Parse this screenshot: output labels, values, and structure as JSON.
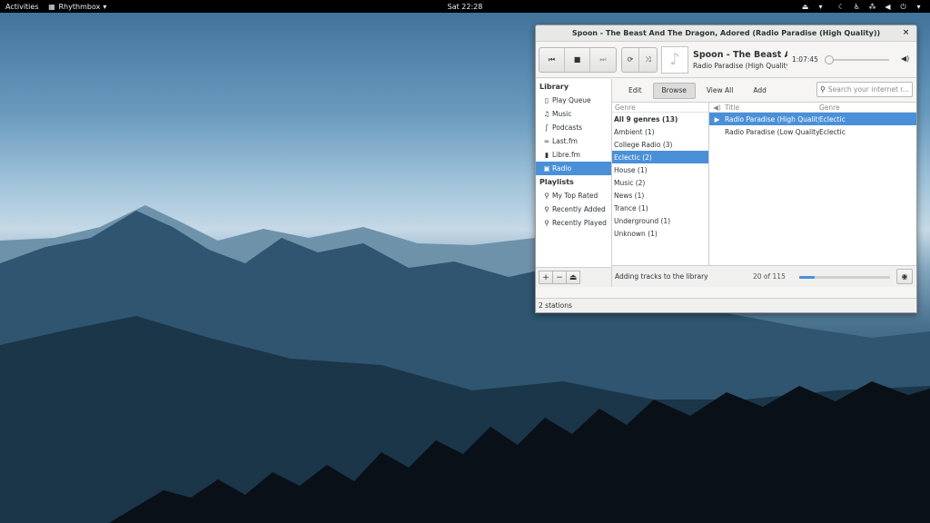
{
  "topbar": {
    "activities": "Activities",
    "app_name": "Rhythmbox",
    "clock": "Sat 22:28"
  },
  "window": {
    "title": "Spoon - The Beast And The Dragon, Adored (Radio Paradise (High Quality))",
    "close": "×",
    "status": "2 stations"
  },
  "player": {
    "now_title": "Spoon - The Beast An…",
    "now_artist": "Radio Paradise (High Quality)",
    "elapsed": "1:07:45",
    "seek_fraction": 0.0
  },
  "sidebar": {
    "library_heading": "Library",
    "library_items": [
      {
        "label": "Play Queue",
        "icon": "document-icon",
        "glyph": "▯"
      },
      {
        "label": "Music",
        "icon": "music-note-icon",
        "glyph": "♫"
      },
      {
        "label": "Podcasts",
        "icon": "rss-icon",
        "glyph": "ʃ"
      },
      {
        "label": "Last.fm",
        "icon": "lastfm-icon",
        "glyph": "∞"
      },
      {
        "label": "Libre.fm",
        "icon": "device-icon",
        "glyph": "▮"
      },
      {
        "label": "Radio",
        "icon": "radio-icon",
        "glyph": "▣"
      }
    ],
    "playlists_heading": "Playlists",
    "playlist_items": [
      {
        "label": "My Top Rated",
        "icon": "search-icon",
        "glyph": "⚲"
      },
      {
        "label": "Recently Added",
        "icon": "search-icon",
        "glyph": "⚲"
      },
      {
        "label": "Recently Played",
        "icon": "search-icon",
        "glyph": "⚲"
      }
    ]
  },
  "browse": {
    "edit": "Edit",
    "browse": "Browse",
    "view_all": "View All",
    "add": "Add",
    "search_placeholder": "Search your internet r..."
  },
  "genres": {
    "header": "Genre",
    "items": [
      "All 9 genres (13)",
      "Ambient (1)",
      "College Radio (3)",
      "Eclectic (2)",
      "House (1)",
      "Music (2)",
      "News (1)",
      "Trance (1)",
      "Underground (1)",
      "Unknown (1)"
    ],
    "selected_index": 3
  },
  "tracks": {
    "title_header": "Title",
    "genre_header": "Genre",
    "rows": [
      {
        "title": "Radio Paradise (High Quality)",
        "genre": "Eclectic",
        "playing": "▶"
      },
      {
        "title": "Radio Paradise (Low Quality)",
        "genre": "Eclectic",
        "playing": ""
      }
    ]
  },
  "progress": {
    "message": "Adding tracks to the library",
    "count": "20 of 115",
    "fraction": 0.174
  },
  "colors": {
    "accent": "#4a90d9"
  }
}
